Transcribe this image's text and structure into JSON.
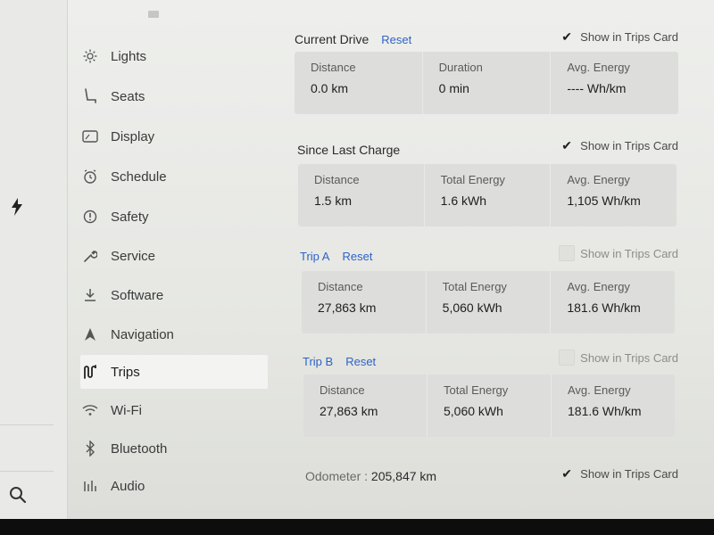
{
  "sidebar": {
    "items": [
      {
        "label": "Lights",
        "icon": "sun-icon"
      },
      {
        "label": "Seats",
        "icon": "seat-icon"
      },
      {
        "label": "Display",
        "icon": "display-icon"
      },
      {
        "label": "Schedule",
        "icon": "clock-icon"
      },
      {
        "label": "Safety",
        "icon": "safety-icon"
      },
      {
        "label": "Service",
        "icon": "wrench-icon"
      },
      {
        "label": "Software",
        "icon": "download-icon"
      },
      {
        "label": "Navigation",
        "icon": "navigation-icon"
      },
      {
        "label": "Trips",
        "icon": "trips-icon"
      },
      {
        "label": "Wi-Fi",
        "icon": "wifi-icon"
      },
      {
        "label": "Bluetooth",
        "icon": "bluetooth-icon"
      },
      {
        "label": "Audio",
        "icon": "audio-icon"
      }
    ],
    "active": "Trips"
  },
  "current_drive": {
    "title": "Current Drive",
    "reset": "Reset",
    "show_label": "Show in Trips Card",
    "show_checked": true,
    "cells": [
      {
        "label": "Distance",
        "value": "0.0 km"
      },
      {
        "label": "Duration",
        "value": "0 min"
      },
      {
        "label": "Avg. Energy",
        "value": "---- Wh/km"
      }
    ]
  },
  "since_last_charge": {
    "title": "Since Last Charge",
    "show_label": "Show in Trips Card",
    "show_checked": true,
    "cells": [
      {
        "label": "Distance",
        "value": "1.5 km"
      },
      {
        "label": "Total Energy",
        "value": "1.6 kWh"
      },
      {
        "label": "Avg. Energy",
        "value": "1,105 Wh/km"
      }
    ]
  },
  "trip_a": {
    "title": "Trip A",
    "reset": "Reset",
    "show_label": "Show in Trips Card",
    "show_checked": false,
    "cells": [
      {
        "label": "Distance",
        "value": "27,863 km"
      },
      {
        "label": "Total Energy",
        "value": "5,060 kWh"
      },
      {
        "label": "Avg. Energy",
        "value": "181.6 Wh/km"
      }
    ]
  },
  "trip_b": {
    "title": "Trip B",
    "reset": "Reset",
    "show_label": "Show in Trips Card",
    "show_checked": false,
    "cells": [
      {
        "label": "Distance",
        "value": "27,863 km"
      },
      {
        "label": "Total Energy",
        "value": "5,060 kWh"
      },
      {
        "label": "Avg. Energy",
        "value": "181.6 Wh/km"
      }
    ]
  },
  "odometer": {
    "label": "Odometer :",
    "value": "205,847 km",
    "show_label": "Show in Trips Card",
    "show_checked": true
  },
  "colors": {
    "accent": "#2d63c8",
    "card": "#dddedb",
    "background": "#e8e9e6"
  }
}
